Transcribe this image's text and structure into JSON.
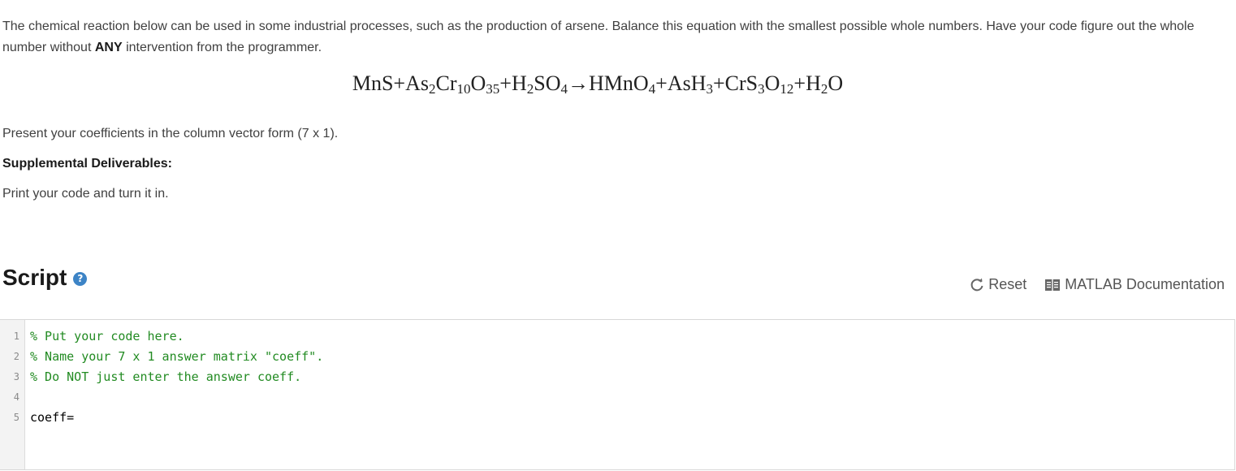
{
  "problem": {
    "paragraph_part1": "The chemical reaction below can be used in some industrial processes, such as the production of arsene. Balance this equation with the smallest possible whole numbers. Have your code figure out the whole number without ",
    "paragraph_bold": "ANY",
    "paragraph_part2": " intervention from the programmer.",
    "equation": {
      "mns": "MnS",
      "plus": "+",
      "as": "As",
      "as_sub": "2",
      "cr": "Cr",
      "cr_sub": "10",
      "o": "O",
      "o_sub": "35",
      "h": "H",
      "h_sub": "2",
      "so": "SO",
      "so_sub": "4",
      "arrow": "→",
      "hmno": "HMnO",
      "hmno_sub": "4",
      "ash": "AsH",
      "ash_sub": "3",
      "crs": "CrS",
      "crs_sub": "3",
      "o2": "O",
      "o2_sub": "12",
      "h2": "H",
      "h2_sub": "2",
      "water_o": "O"
    },
    "present_text": "Present your coefficients in the column vector form (7 x 1).",
    "supplemental_heading": "Supplemental Deliverables:",
    "print_text": "Print your code and turn it in."
  },
  "script": {
    "title": "Script",
    "help_icon": "?",
    "reset_label": "Reset",
    "docs_label": "MATLAB Documentation"
  },
  "editor": {
    "line_numbers": [
      "1",
      "2",
      "3",
      "4",
      "5"
    ],
    "lines": [
      "% Put your code here.",
      "% Name your 7 x 1 answer matrix \"coeff\".",
      "% Do NOT just enter the answer coeff.",
      "",
      "coeff="
    ],
    "comment_color": "#228b22"
  }
}
